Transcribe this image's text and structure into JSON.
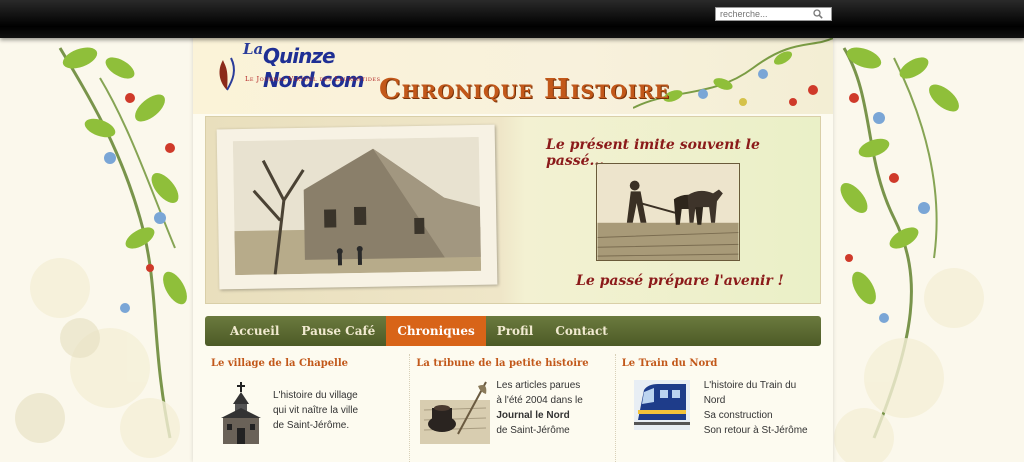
{
  "search": {
    "placeholder": "recherche..."
  },
  "header": {
    "logo_la": "La",
    "logo_main": "Quinze Nord.com",
    "logo_tagline": "Le Journal Virtuel des Laurentides",
    "title": "Chronique Histoire"
  },
  "banner": {
    "quote_top": "Le présent imite souvent le passé...",
    "quote_bottom": "Le passé prépare l'avenir !"
  },
  "nav": {
    "items": [
      {
        "label": "Accueil",
        "active": false
      },
      {
        "label": "Pause Café",
        "active": false
      },
      {
        "label": "Chroniques",
        "active": true
      },
      {
        "label": "Profil",
        "active": false
      },
      {
        "label": "Contact",
        "active": false
      }
    ]
  },
  "columns": [
    {
      "title": "Le village de la Chapelle",
      "icon": "chapel-icon",
      "lines": [
        "L'histoire du village",
        "qui vit naître la ville",
        "de Saint-Jérôme."
      ]
    },
    {
      "title": "La tribune de la petite histoire",
      "icon": "inkwell-quill-icon",
      "lines": [
        "Les articles parues",
        "à l'été 2004 dans le",
        "Journal le Nord",
        "de Saint-Jérôme"
      ]
    },
    {
      "title": "Le Train du Nord",
      "icon": "train-icon",
      "lines": [
        "L'histoire du Train du",
        "Nord",
        "Sa construction",
        "Son retour à St-Jérôme"
      ]
    }
  ],
  "colors": {
    "nav_active": "#d86418",
    "nav_bg": "#5b6a30",
    "title_orange": "#c2581a",
    "quote_red": "#8b1a1a"
  }
}
